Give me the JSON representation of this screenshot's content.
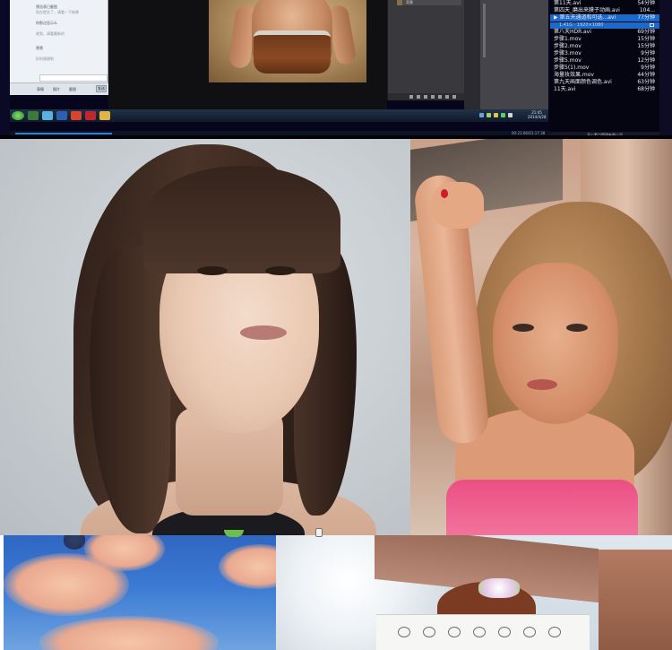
{
  "chat": {
    "lines": [
      "预览表已截图",
      "现在提交了，请看一下结果",
      "你那边显示么",
      "收到，请看最新的",
      "嗯嗯",
      "好的谢谢啦"
    ],
    "send_label": "发送",
    "tools": [
      "表情",
      "图片",
      "截图"
    ]
  },
  "photoshop": {
    "layer_name": "背景"
  },
  "taskbar": {
    "clock": "21:45\n2014/4/28"
  },
  "player": {
    "time": "00:21:06/01:17:38"
  },
  "playlist": {
    "items": [
      {
        "name": "第11天.avi",
        "duration": "54分钟",
        "active": false
      },
      {
        "name": "第四天_磨出来膜子动画.avi",
        "duration": "104...",
        "active": false
      },
      {
        "name": "▶ 第五天通道和可选...avi",
        "duration": "77分钟",
        "active": true
      },
      {
        "name": "第八天HDR.avi",
        "duration": "69分钟",
        "active": false
      },
      {
        "name": "步骤1.mov",
        "duration": "15分钟",
        "active": false
      },
      {
        "name": "步骤2.mov",
        "duration": "15分钟",
        "active": false
      },
      {
        "name": "步骤3.mov",
        "duration": "9分钟",
        "active": false
      },
      {
        "name": "步骤5.mov",
        "duration": "12分钟",
        "active": false
      },
      {
        "name": "步骤5(1).mov",
        "duration": "9分钟",
        "active": false
      },
      {
        "name": "海量妆效果.mov",
        "duration": "44分钟",
        "active": false
      },
      {
        "name": "第九天画面颜色调色.avi",
        "duration": "63分钟",
        "active": false
      },
      {
        "name": "11天.avi",
        "duration": "68分钟",
        "active": false
      }
    ],
    "detail": "1.41G · 1920×1080",
    "footer": "开心看点管理有限公司"
  },
  "colors": {
    "playlist_active": "#1c69c9",
    "progress": "#2d7fd6",
    "dress_pink": "#ea4f83"
  },
  "player_progress_fraction": 0.18
}
